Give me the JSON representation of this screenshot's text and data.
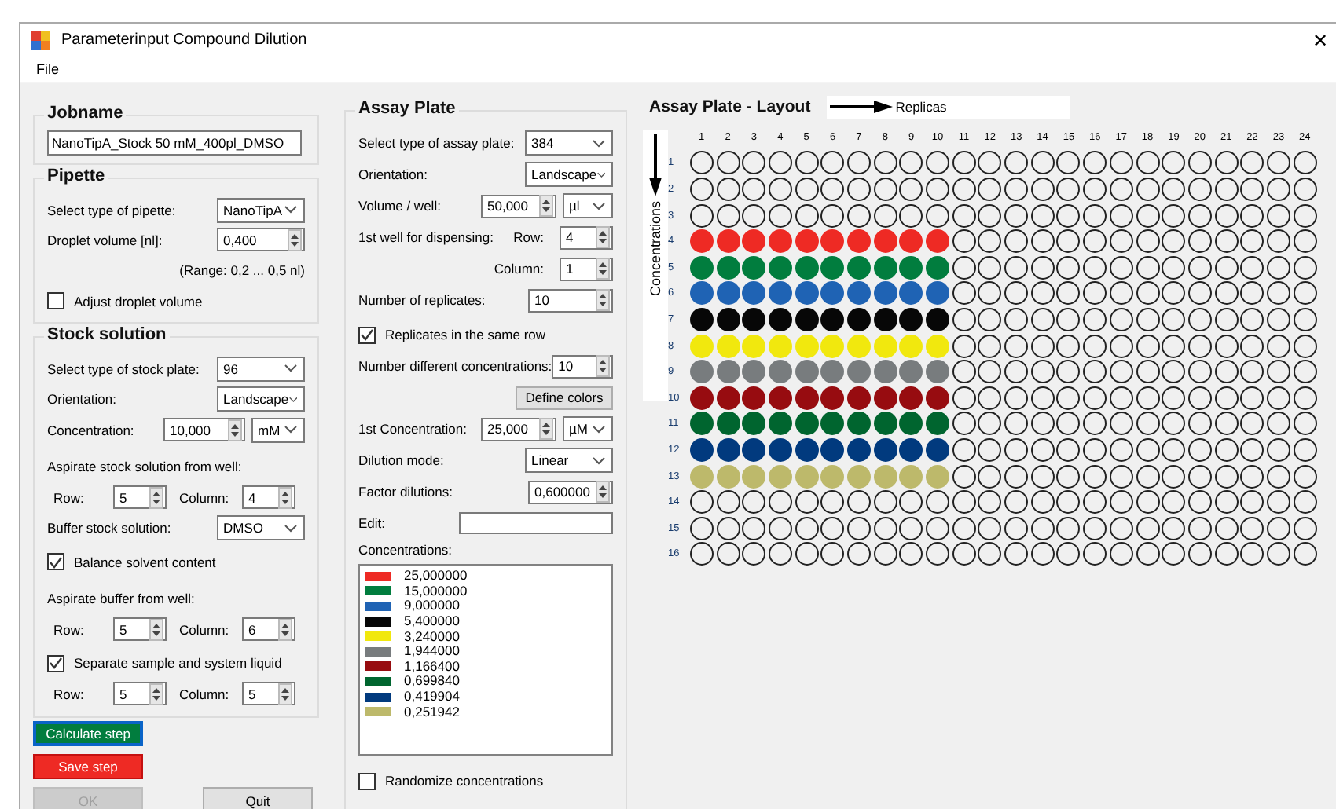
{
  "window": {
    "title": "Parameterinput Compound Dilution",
    "close": "✕"
  },
  "menu": [
    "File"
  ],
  "jobname": {
    "title": "Jobname",
    "value": "NanoTipA_Stock 50 mM_400pl_DMSO"
  },
  "pipette": {
    "title": "Pipette",
    "fields": [
      {
        "kind": "select",
        "label": "Select type of pipette:",
        "value": "NanoTipA"
      },
      {
        "kind": "spin",
        "label": "Droplet volume [nl]:",
        "value": "0,400"
      },
      {
        "kind": "note",
        "text": "(Range: 0,2 ... 0,5 nl)"
      },
      {
        "kind": "check",
        "label": "Adjust droplet volume",
        "checked": false
      }
    ]
  },
  "stock": {
    "title": "Stock solution",
    "fields": [
      {
        "kind": "select",
        "label": "Select type of stock plate:",
        "value": "96"
      },
      {
        "kind": "select",
        "label": "Orientation:",
        "value": "Landscape"
      },
      {
        "kind": "spin_unit",
        "label": "Concentration:",
        "value": "10,000",
        "unit": "mM"
      },
      {
        "kind": "caption",
        "text": "Aspirate stock solution from well:"
      },
      {
        "kind": "pair",
        "items": [
          {
            "label": "Row:",
            "value": "5"
          },
          {
            "label": "Column:",
            "value": "4"
          }
        ]
      },
      {
        "kind": "select",
        "label": "Buffer stock solution:",
        "value": "DMSO"
      },
      {
        "kind": "check",
        "label": "Balance solvent content",
        "checked": true
      },
      {
        "kind": "caption",
        "text": "Aspirate buffer from well:"
      },
      {
        "kind": "pair",
        "items": [
          {
            "label": "Row:",
            "value": "5"
          },
          {
            "label": "Column:",
            "value": "6"
          }
        ]
      },
      {
        "kind": "check",
        "label": "Separate sample and system liquid",
        "checked": true
      },
      {
        "kind": "pair",
        "items": [
          {
            "label": "Row:",
            "value": "5"
          },
          {
            "label": "Column:",
            "value": "5"
          }
        ]
      }
    ]
  },
  "buttons": [
    {
      "label": "Calculate step",
      "kind": "go",
      "disabled": false
    },
    {
      "label": "Save step",
      "kind": "save",
      "disabled": false
    },
    {
      "label": "OK",
      "kind": "plain",
      "disabled": true
    },
    {
      "label": "Quit",
      "kind": "plain",
      "disabled": false
    }
  ],
  "assay": {
    "title": "Assay Plate",
    "fields": [
      {
        "kind": "select",
        "label": "Select type of assay plate:",
        "value": "384"
      },
      {
        "kind": "select",
        "label": "Orientation:",
        "value": "Landscape"
      },
      {
        "kind": "spin_unit",
        "label": "Volume / well:",
        "value": "50,000",
        "unit": "µl"
      },
      {
        "kind": "spin2",
        "label": "1st well for dispensing:",
        "sublabel": "Row:",
        "value": "4"
      },
      {
        "kind": "spin_right",
        "label": "Column:",
        "value": "1"
      },
      {
        "kind": "spin",
        "label": "Number of replicates:",
        "value": "10"
      },
      {
        "kind": "check",
        "label": "Replicates in the same row",
        "checked": true
      },
      {
        "kind": "spin",
        "label": "Number different concentrations:",
        "value": "10"
      },
      {
        "kind": "button",
        "label": "Define colors"
      },
      {
        "kind": "spin_unit",
        "label": "1st Concentration:",
        "value": "25,000",
        "unit": "µM"
      },
      {
        "kind": "select",
        "label": "Dilution mode:",
        "value": "Linear"
      },
      {
        "kind": "spin",
        "label": "Factor dilutions:",
        "value": "0,600000"
      },
      {
        "kind": "text",
        "label": "Edit:"
      },
      {
        "kind": "list",
        "label": "Concentrations:",
        "items": [
          {
            "color": "#ee2a24",
            "value": "25,000000"
          },
          {
            "color": "#017d3e",
            "value": "15,000000"
          },
          {
            "color": "#1f63b4",
            "value": "9,000000"
          },
          {
            "color": "#070707",
            "value": "5,400000"
          },
          {
            "color": "#f1e80e",
            "value": "3,240000"
          },
          {
            "color": "#787c7e",
            "value": "1,944000"
          },
          {
            "color": "#970c10",
            "value": "1,166400"
          },
          {
            "color": "#00652f",
            "value": "0,699840"
          },
          {
            "color": "#013a7e",
            "value": "0,419904"
          },
          {
            "color": "#bdb96b",
            "value": "0,251942"
          }
        ]
      },
      {
        "kind": "check",
        "label": "Randomize concentrations",
        "checked": false
      }
    ]
  },
  "layout": {
    "title": "Assay Plate - Layout",
    "replicas_label": "Replicas",
    "concentrations_label": "Concentrations",
    "columns": [
      {
        "label": "1",
        "used": true
      },
      {
        "label": "2",
        "used": true
      },
      {
        "label": "3",
        "used": true
      },
      {
        "label": "4",
        "used": true
      },
      {
        "label": "5",
        "used": true
      },
      {
        "label": "6",
        "used": true
      },
      {
        "label": "7",
        "used": true
      },
      {
        "label": "8",
        "used": true
      },
      {
        "label": "9",
        "used": true
      },
      {
        "label": "10",
        "used": true
      },
      {
        "label": "11",
        "used": false
      },
      {
        "label": "12",
        "used": false
      },
      {
        "label": "13",
        "used": false
      },
      {
        "label": "14",
        "used": false
      },
      {
        "label": "15",
        "used": false
      },
      {
        "label": "16",
        "used": false
      },
      {
        "label": "17",
        "used": false
      },
      {
        "label": "18",
        "used": false
      },
      {
        "label": "19",
        "used": false
      },
      {
        "label": "20",
        "used": false
      },
      {
        "label": "21",
        "used": false
      },
      {
        "label": "22",
        "used": false
      },
      {
        "label": "23",
        "used": false
      },
      {
        "label": "24",
        "used": false
      }
    ],
    "rows": [
      {
        "label": "1"
      },
      {
        "label": "2"
      },
      {
        "label": "3"
      },
      {
        "label": "4",
        "color": "#ee2a24"
      },
      {
        "label": "5",
        "color": "#017d3e"
      },
      {
        "label": "6",
        "color": "#1f63b4"
      },
      {
        "label": "7",
        "color": "#070707"
      },
      {
        "label": "8",
        "color": "#f1e80e"
      },
      {
        "label": "9",
        "color": "#787c7e"
      },
      {
        "label": "10",
        "color": "#970c10"
      },
      {
        "label": "11",
        "color": "#00652f"
      },
      {
        "label": "12",
        "color": "#013a7e"
      },
      {
        "label": "13",
        "color": "#bdb96b"
      },
      {
        "label": "14"
      },
      {
        "label": "15"
      },
      {
        "label": "16"
      }
    ]
  }
}
